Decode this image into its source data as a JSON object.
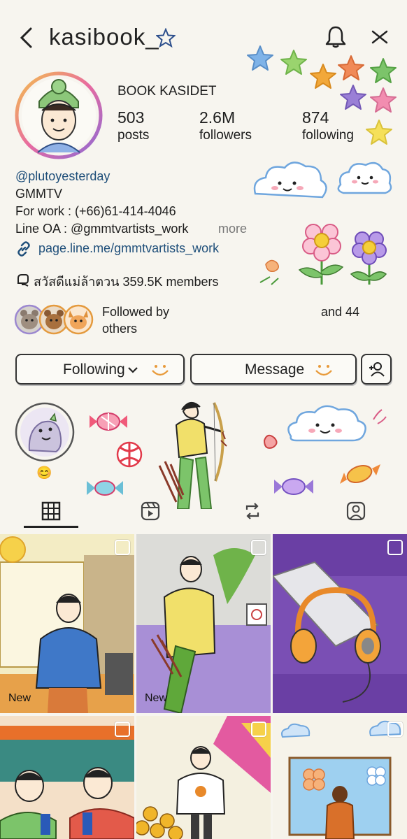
{
  "header": {
    "username": "kasibook_",
    "icons": [
      "back-chevron-icon",
      "star-icon",
      "bell-icon",
      "more-icon"
    ]
  },
  "profile": {
    "display_name": "BOOK KASIDET",
    "stats": [
      {
        "value": "503",
        "label": "posts"
      },
      {
        "value": "2.6M",
        "label": "followers"
      },
      {
        "value": "874",
        "label": "following"
      }
    ],
    "bio": {
      "handle": "@plutoyesterday",
      "line1": "GMMTV",
      "line2": "For work : (+66)61-414-4046",
      "line3": "Line OA : @gmmtvartists_work",
      "more": "more",
      "link": "page.line.me/gmmtvartists_work"
    },
    "channel": "สวัสดีแม่ล้าตวน 359.5K members",
    "followed_by": {
      "prefix": "Followed by",
      "and": "and 44",
      "others": "others"
    }
  },
  "actions": {
    "following": "Following",
    "message": "Message"
  },
  "highlight": {
    "label": "😊"
  },
  "tabs": [
    "grid-icon",
    "reels-icon",
    "reposts-icon",
    "tagged-icon"
  ],
  "grid": {
    "new_labels": [
      "New",
      "New"
    ]
  },
  "colors": {
    "paper": "#f7f5ef",
    "ink": "#1d1d1d",
    "link": "#1f4f7a",
    "accent_orange": "#e8a23a"
  }
}
